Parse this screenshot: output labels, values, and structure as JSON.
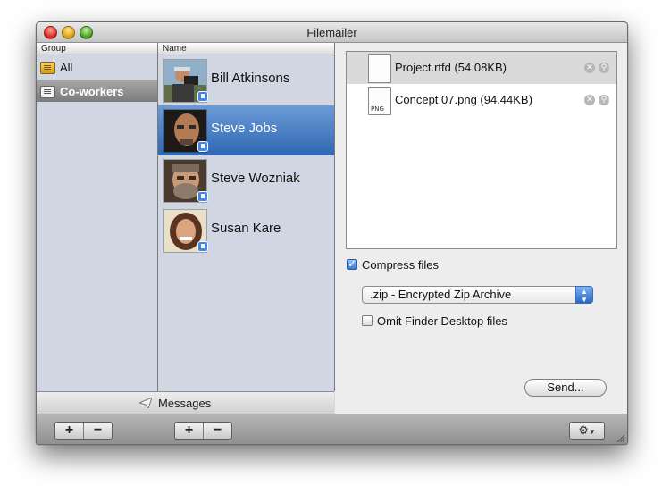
{
  "window": {
    "title": "Filemailer"
  },
  "groups": {
    "header": "Group",
    "items": [
      {
        "label": "All",
        "icon": "address-book-icon"
      },
      {
        "label": "Co-workers",
        "icon": "group-card-icon"
      }
    ]
  },
  "names": {
    "header": "Name",
    "items": [
      {
        "name": "Bill Atkinsons"
      },
      {
        "name": "Steve Jobs"
      },
      {
        "name": "Steve Wozniak"
      },
      {
        "name": "Susan Kare"
      }
    ]
  },
  "messages": {
    "label": "Messages"
  },
  "files": [
    {
      "name": "Project.rtfd (54.08KB)",
      "type": ""
    },
    {
      "name": "Concept 07.png (94.44KB)",
      "type": "PNG"
    }
  ],
  "options": {
    "compress_label": "Compress files",
    "compress_checked": true,
    "archive_format": ".zip - Encrypted Zip Archive",
    "omit_label": "Omit Finder Desktop files",
    "omit_checked": false
  },
  "send_button": "Send...",
  "toolbar": {
    "add": "+",
    "remove": "−"
  },
  "colors": {
    "selection_blue": "#2f67b4",
    "sidebar_bg": "#d1d7e2"
  }
}
